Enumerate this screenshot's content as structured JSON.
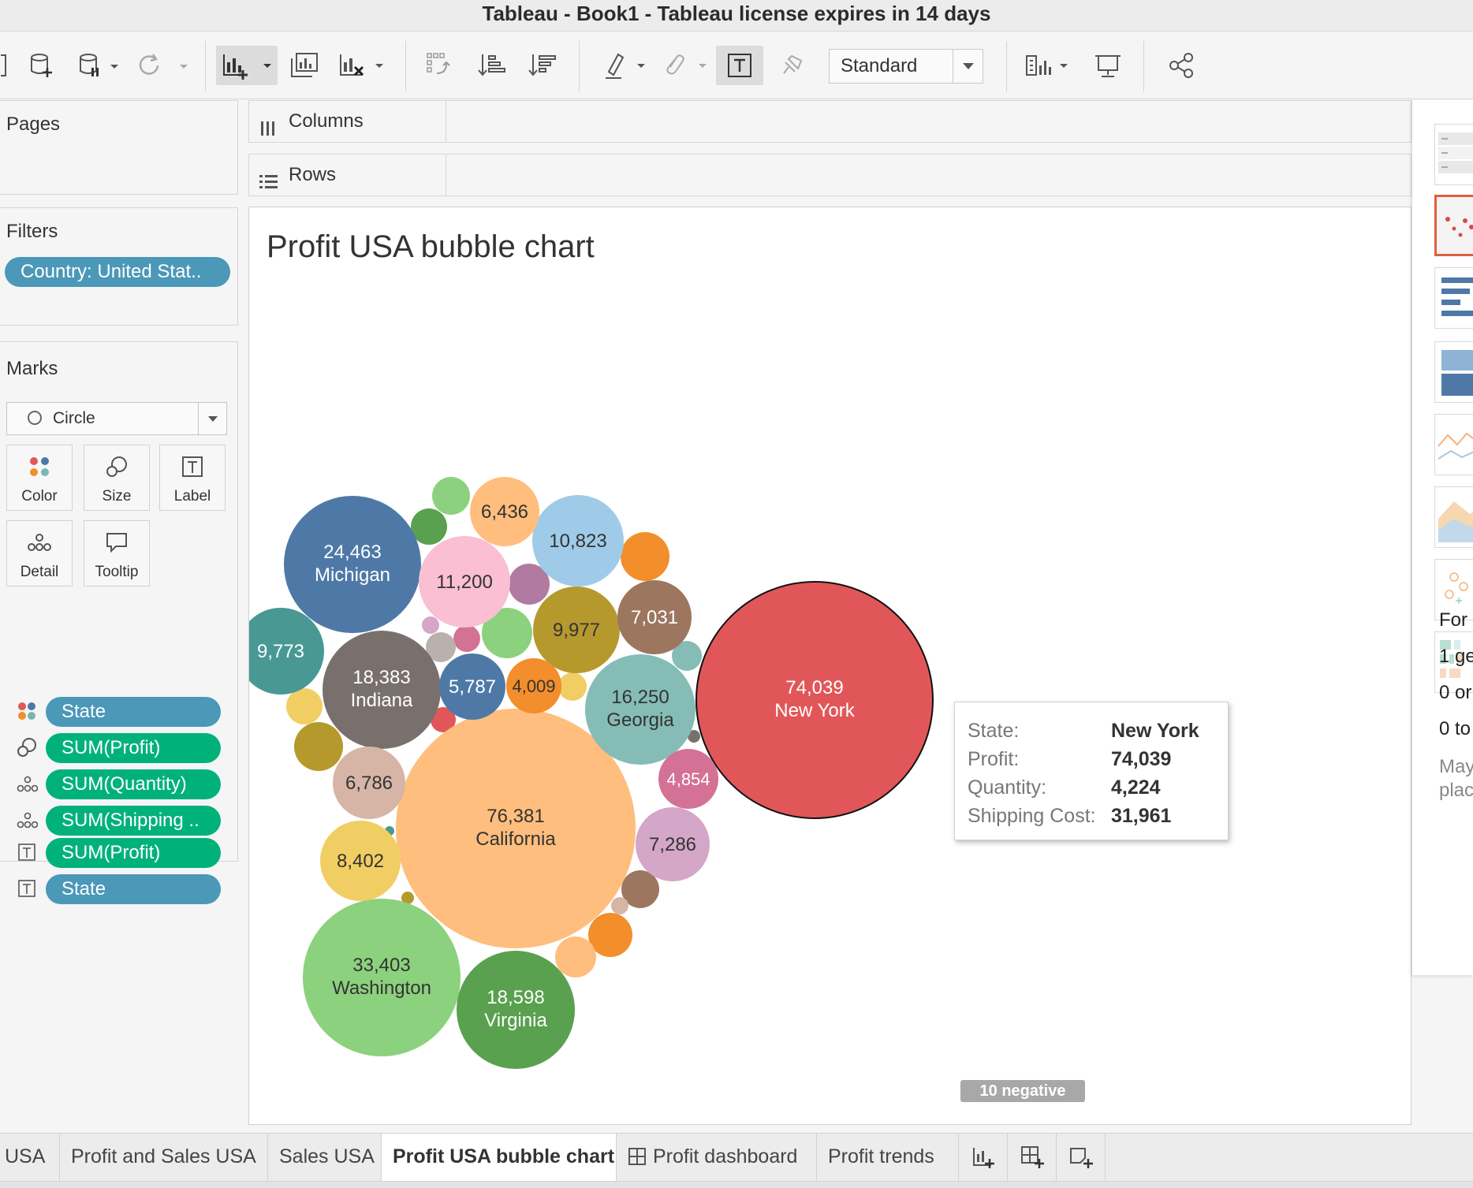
{
  "window": {
    "title": "Tableau - Book1 - Tableau license expires in 14 days"
  },
  "toolbar": {
    "fit_select": "Standard",
    "icons": [
      "new-data-source-icon",
      "pause-updates-icon",
      "refresh-icon",
      "new-worksheet-icon",
      "duplicate-sheet-icon",
      "clear-sheet-icon",
      "swap-rows-columns-icon",
      "sort-ascending-icon",
      "sort-descending-icon",
      "highlight-icon",
      "group-members-icon",
      "show-mark-labels-icon",
      "fix-axes-icon",
      "show-cards-icon",
      "presentation-mode-icon",
      "share-icon"
    ]
  },
  "panels": {
    "pages": "Pages",
    "filters": "Filters",
    "filter_pill": "Country: United Stat..",
    "marks": "Marks",
    "mark_type": "Circle",
    "mark_buttons": [
      "Color",
      "Size",
      "Label",
      "Detail",
      "Tooltip"
    ],
    "mark_fields": [
      {
        "label": "State",
        "type": "dimension",
        "icon": "color-icon"
      },
      {
        "label": "SUM(Profit)",
        "type": "measure",
        "icon": "size-icon"
      },
      {
        "label": "SUM(Quantity)",
        "type": "measure",
        "icon": "detail-icon"
      },
      {
        "label": "SUM(Shipping ..",
        "type": "measure",
        "icon": "detail-icon"
      },
      {
        "label": "SUM(Profit)",
        "type": "measure",
        "icon": "label-icon"
      },
      {
        "label": "State",
        "type": "dimension",
        "icon": "label-icon"
      }
    ]
  },
  "shelves": {
    "columns": "Columns",
    "rows": "Rows"
  },
  "viz": {
    "title": "Profit USA bubble chart",
    "negative_badge": "10 negative",
    "tooltip": {
      "keys": [
        "State:",
        "Profit:",
        "Quantity:",
        "Shipping Cost:"
      ],
      "values": [
        "New York",
        "74,039",
        "4,224",
        "31,961"
      ]
    }
  },
  "chart_data": {
    "type": "bubble",
    "title": "Profit USA bubble chart",
    "size_field": "SUM(Profit)",
    "color_field": "State",
    "labeled_bubbles": [
      {
        "state": "California",
        "profit": 76381,
        "label": "76,381",
        "color": "#ffbe7d"
      },
      {
        "state": "New York",
        "profit": 74039,
        "label": "74,039",
        "color": "#e15759"
      },
      {
        "state": "Washington",
        "profit": 33403,
        "label": "33,403",
        "color": "#8cd17d"
      },
      {
        "state": "Michigan",
        "profit": 24463,
        "label": "24,463",
        "color": "#4e79a7"
      },
      {
        "state": "Virginia",
        "profit": 18598,
        "label": "18,598",
        "color": "#59a14f"
      },
      {
        "state": "Indiana",
        "profit": 18383,
        "label": "18,383",
        "color": "#79706e"
      },
      {
        "state": "Georgia",
        "profit": 16250,
        "label": "16,250",
        "color": "#86bcb6"
      }
    ],
    "unnamed_labeled_values": [
      {
        "profit": 11200,
        "label": "11,200",
        "color": "#fabfd2"
      },
      {
        "profit": 10823,
        "label": "10,823",
        "color": "#a0cbe8"
      },
      {
        "profit": 9977,
        "label": "9,977",
        "color": "#b6992d"
      },
      {
        "profit": 9773,
        "label": "9,773",
        "color": "#499894"
      },
      {
        "profit": 8402,
        "label": "8,402",
        "color": "#f1ce63"
      },
      {
        "profit": 7286,
        "label": "7,286",
        "color": "#d4a6c8"
      },
      {
        "profit": 7031,
        "label": "7,031",
        "color": "#9d7660"
      },
      {
        "profit": 6786,
        "label": "6,786",
        "color": "#d7b5a6"
      },
      {
        "profit": 6436,
        "label": "6,436",
        "color": "#ffbe7d"
      },
      {
        "profit": 5787,
        "label": "5,787",
        "color": "#4e79a7"
      },
      {
        "profit": 4854,
        "label": "4,854",
        "color": "#d37295"
      },
      {
        "profit": 4009,
        "label": "4,009",
        "color": "#f28e2b"
      }
    ],
    "negative_count": 10
  },
  "showme": {
    "texts": [
      "For s",
      "1 ge",
      "0 or",
      "0 to",
      "May",
      "place"
    ]
  },
  "tabs": {
    "items": [
      "USA",
      "Profit and Sales USA",
      "Sales USA",
      "Profit USA bubble chart",
      "Profit dashboard",
      "Profit trends"
    ],
    "active": "Profit USA bubble chart"
  }
}
